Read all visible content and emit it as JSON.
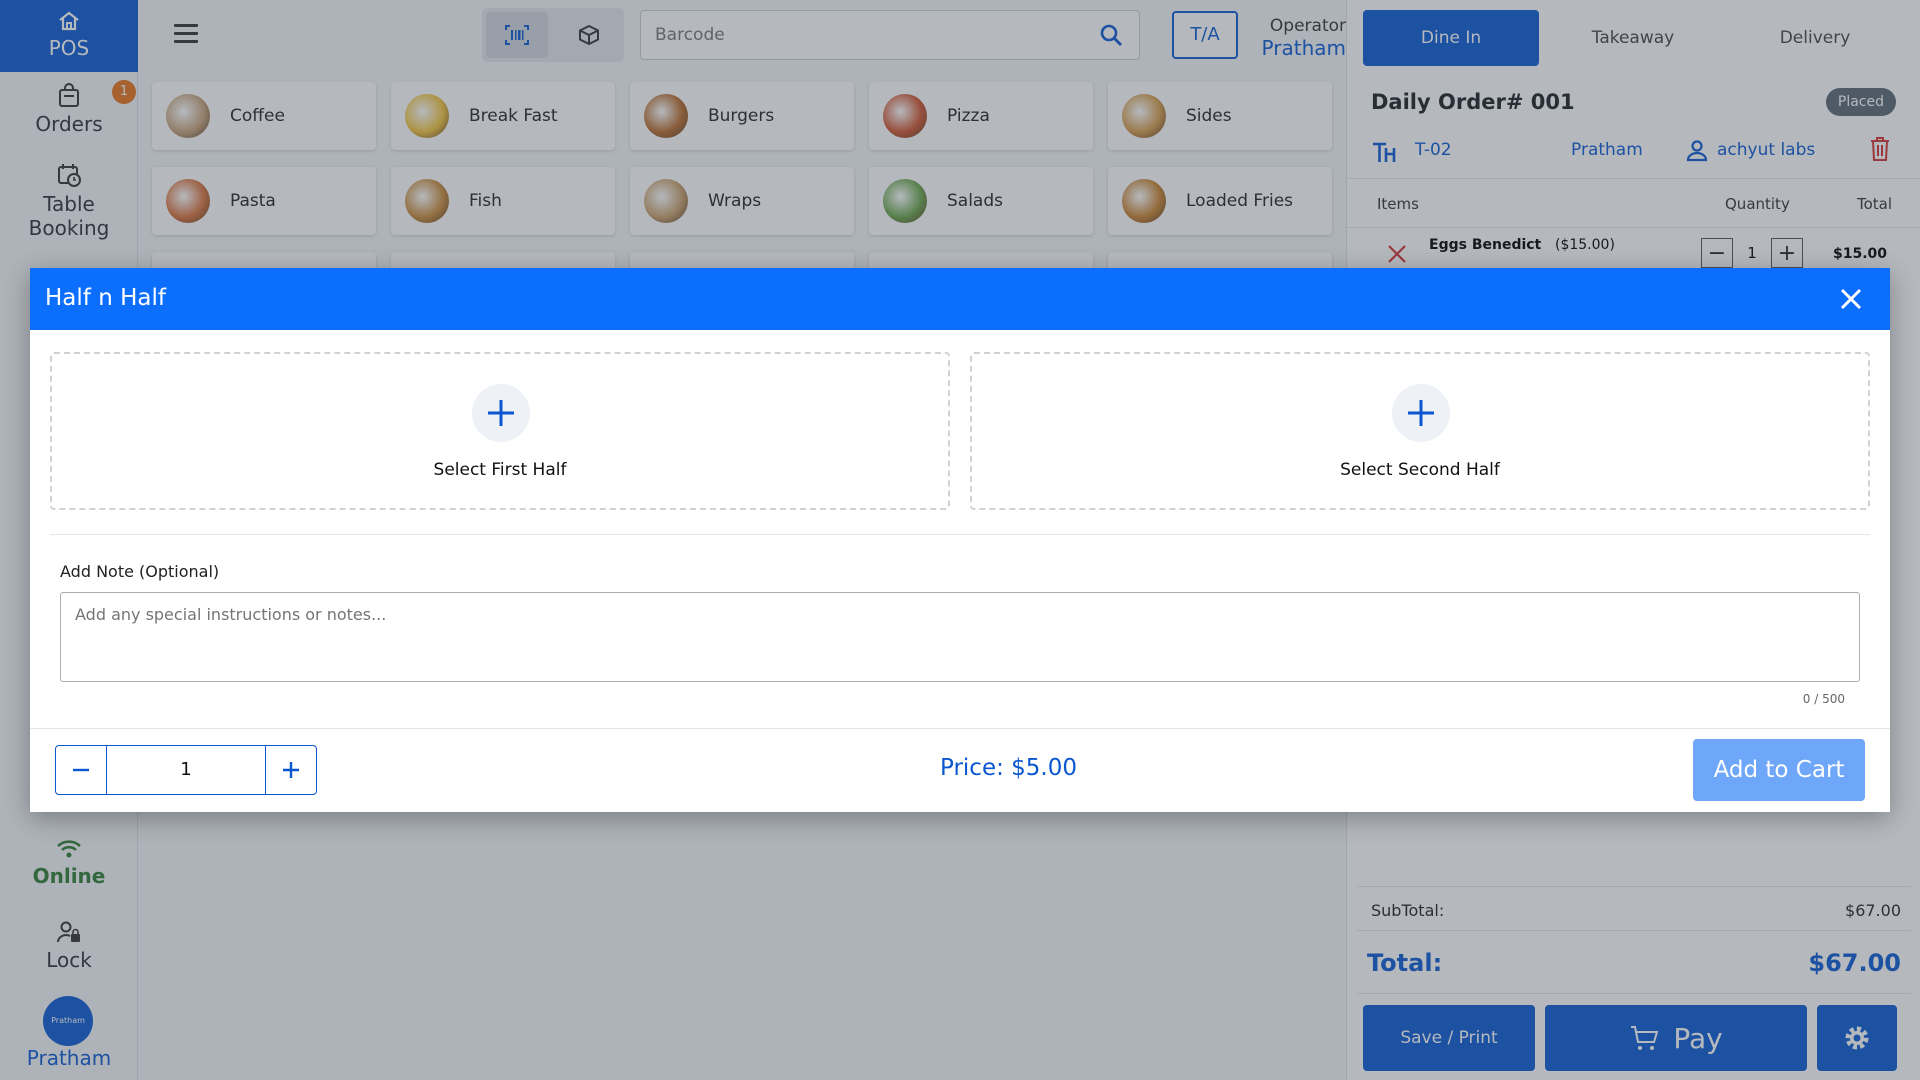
{
  "rail": {
    "pos_label": "POS",
    "orders_label": "Orders",
    "orders_badge": "1",
    "table_label_1": "Table",
    "table_label_2": "Booking",
    "online_label": "Online",
    "lock_label": "Lock",
    "avatar_text": "Pratham",
    "user_label": "Pratham"
  },
  "topbar": {
    "search_placeholder": "Barcode",
    "ta_label": "T/A",
    "operator_label": "Operator",
    "operator_name": "Pratham"
  },
  "categories": [
    {
      "name": "Coffee",
      "color": "#c8a27a"
    },
    {
      "name": "Break Fast",
      "color": "#f2c33b"
    },
    {
      "name": "Burgers",
      "color": "#b86b2c"
    },
    {
      "name": "Pizza",
      "color": "#d1542f"
    },
    {
      "name": "Sides",
      "color": "#d69b4a"
    },
    {
      "name": "Pasta",
      "color": "#d9713c"
    },
    {
      "name": "Fish",
      "color": "#c98a3a"
    },
    {
      "name": "Wraps",
      "color": "#caa06b"
    },
    {
      "name": "Salads",
      "color": "#6aa54a"
    },
    {
      "name": "Loaded Fries",
      "color": "#c9822f"
    }
  ],
  "order": {
    "tabs": [
      "Dine In",
      "Takeaway",
      "Delivery"
    ],
    "title": "Daily Order# 001",
    "status": "Placed",
    "table": "T-02",
    "waiter": "Pratham",
    "customer": "achyut labs",
    "col_items": "Items",
    "col_quantity": "Quantity",
    "col_total": "Total",
    "items": [
      {
        "name": "Eggs Benedict",
        "price": "($15.00)",
        "qty": "1",
        "total": "$15.00"
      }
    ],
    "subtotal_label": "SubTotal:",
    "subtotal_value": "$67.00",
    "total_label": "Total:",
    "total_value": "$67.00",
    "save_print_label": "Save / Print",
    "pay_label": "Pay"
  },
  "modal": {
    "title": "Half n Half",
    "first_half_label": "Select First Half",
    "second_half_label": "Select Second Half",
    "note_label": "Add Note (Optional)",
    "note_placeholder": "Add any special instructions or notes...",
    "note_counter": "0 / 500",
    "quantity": "1",
    "price_label": "Price: $5.00",
    "add_to_cart_label": "Add to Cart"
  },
  "colors": {
    "primary": "#0b57d0",
    "modal_header": "#0c6efd",
    "online": "#2e7d32",
    "badge": "#e8731b",
    "add_to_cart_disabled": "#6ea6f9"
  }
}
